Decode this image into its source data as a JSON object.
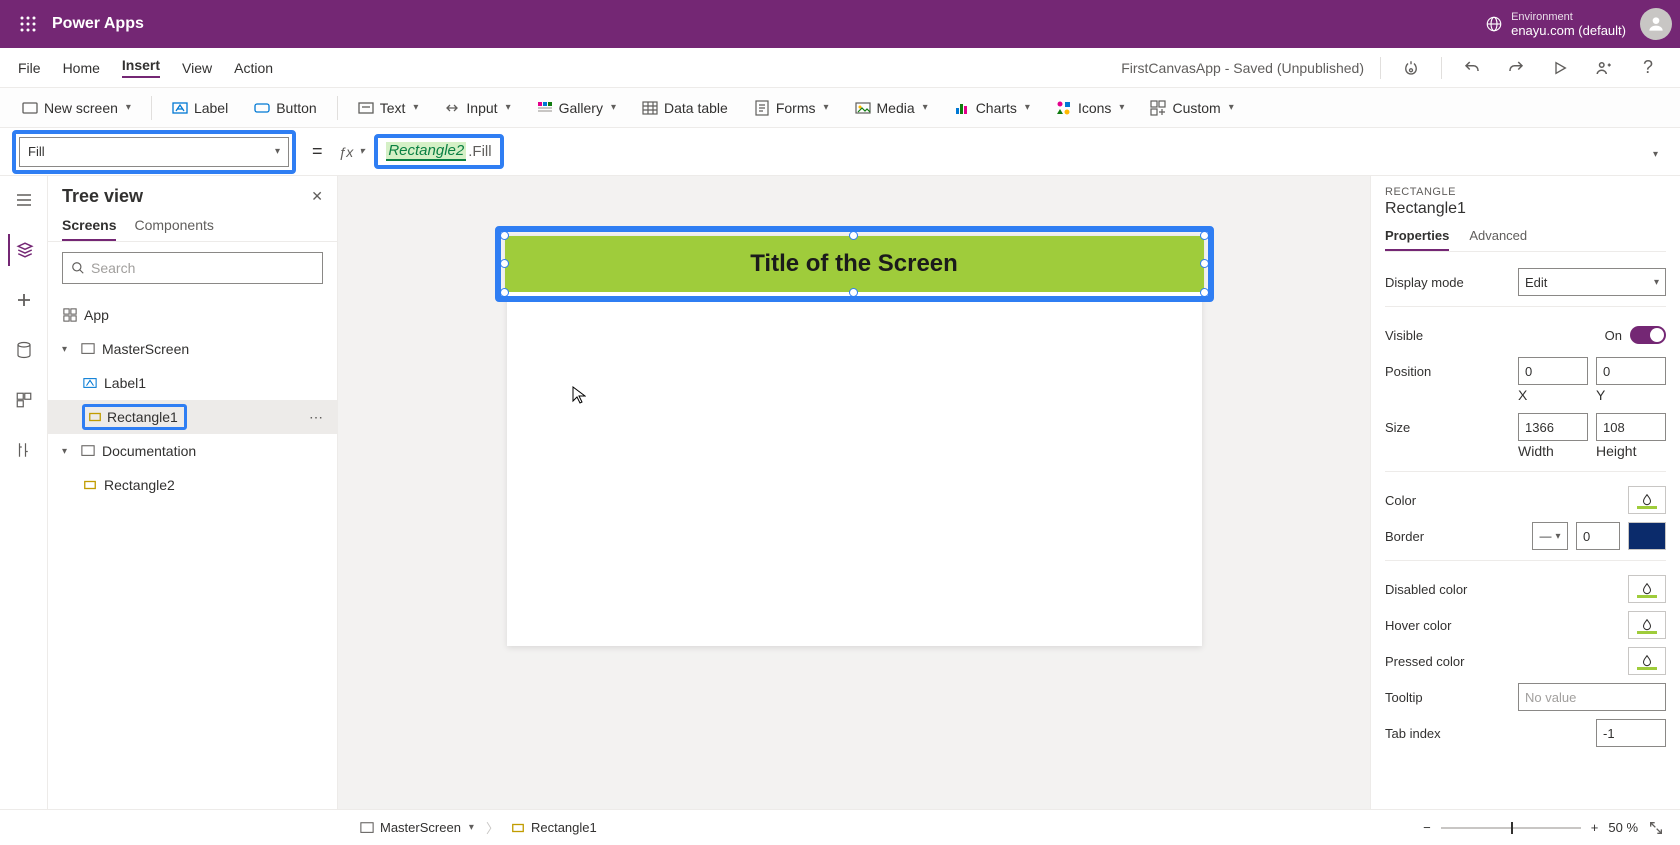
{
  "header": {
    "app_name": "Power Apps",
    "environment_label": "Environment",
    "environment_value": "enayu.com (default)"
  },
  "menu": {
    "items": [
      "File",
      "Home",
      "Insert",
      "View",
      "Action"
    ],
    "active_index": 2,
    "status": "FirstCanvasApp - Saved (Unpublished)"
  },
  "ribbon": {
    "new_screen": "New screen",
    "label": "Label",
    "button": "Button",
    "text": "Text",
    "input": "Input",
    "gallery": "Gallery",
    "data_table": "Data table",
    "forms": "Forms",
    "media": "Media",
    "charts": "Charts",
    "icons": "Icons",
    "custom": "Custom"
  },
  "formula": {
    "property": "Fill",
    "reference": "Rectangle2",
    "suffix": ".Fill"
  },
  "tree": {
    "title": "Tree view",
    "tabs": [
      "Screens",
      "Components"
    ],
    "active_tab": 0,
    "search_placeholder": "Search",
    "app": "App",
    "master_screen": "MasterScreen",
    "label1": "Label1",
    "rectangle1": "Rectangle1",
    "documentation": "Documentation",
    "rectangle2": "Rectangle2"
  },
  "canvas": {
    "title_text": "Title of the Screen"
  },
  "props": {
    "kind": "RECTANGLE",
    "name": "Rectangle1",
    "tabs": [
      "Properties",
      "Advanced"
    ],
    "active_tab": 0,
    "display_mode_label": "Display mode",
    "display_mode_value": "Edit",
    "visible_label": "Visible",
    "visible_value": "On",
    "position_label": "Position",
    "pos_x": "0",
    "pos_y": "0",
    "x_label": "X",
    "y_label": "Y",
    "size_label": "Size",
    "width": "1366",
    "height": "108",
    "width_label": "Width",
    "height_label": "Height",
    "color_label": "Color",
    "border_label": "Border",
    "border_width": "0",
    "disabled_color_label": "Disabled color",
    "hover_color_label": "Hover color",
    "pressed_color_label": "Pressed color",
    "tooltip_label": "Tooltip",
    "tooltip_placeholder": "No value",
    "tabindex_label": "Tab index",
    "tabindex_value": "-1"
  },
  "status": {
    "screen": "MasterScreen",
    "selection": "Rectangle1",
    "zoom": "50",
    "zoom_suffix": "%"
  }
}
